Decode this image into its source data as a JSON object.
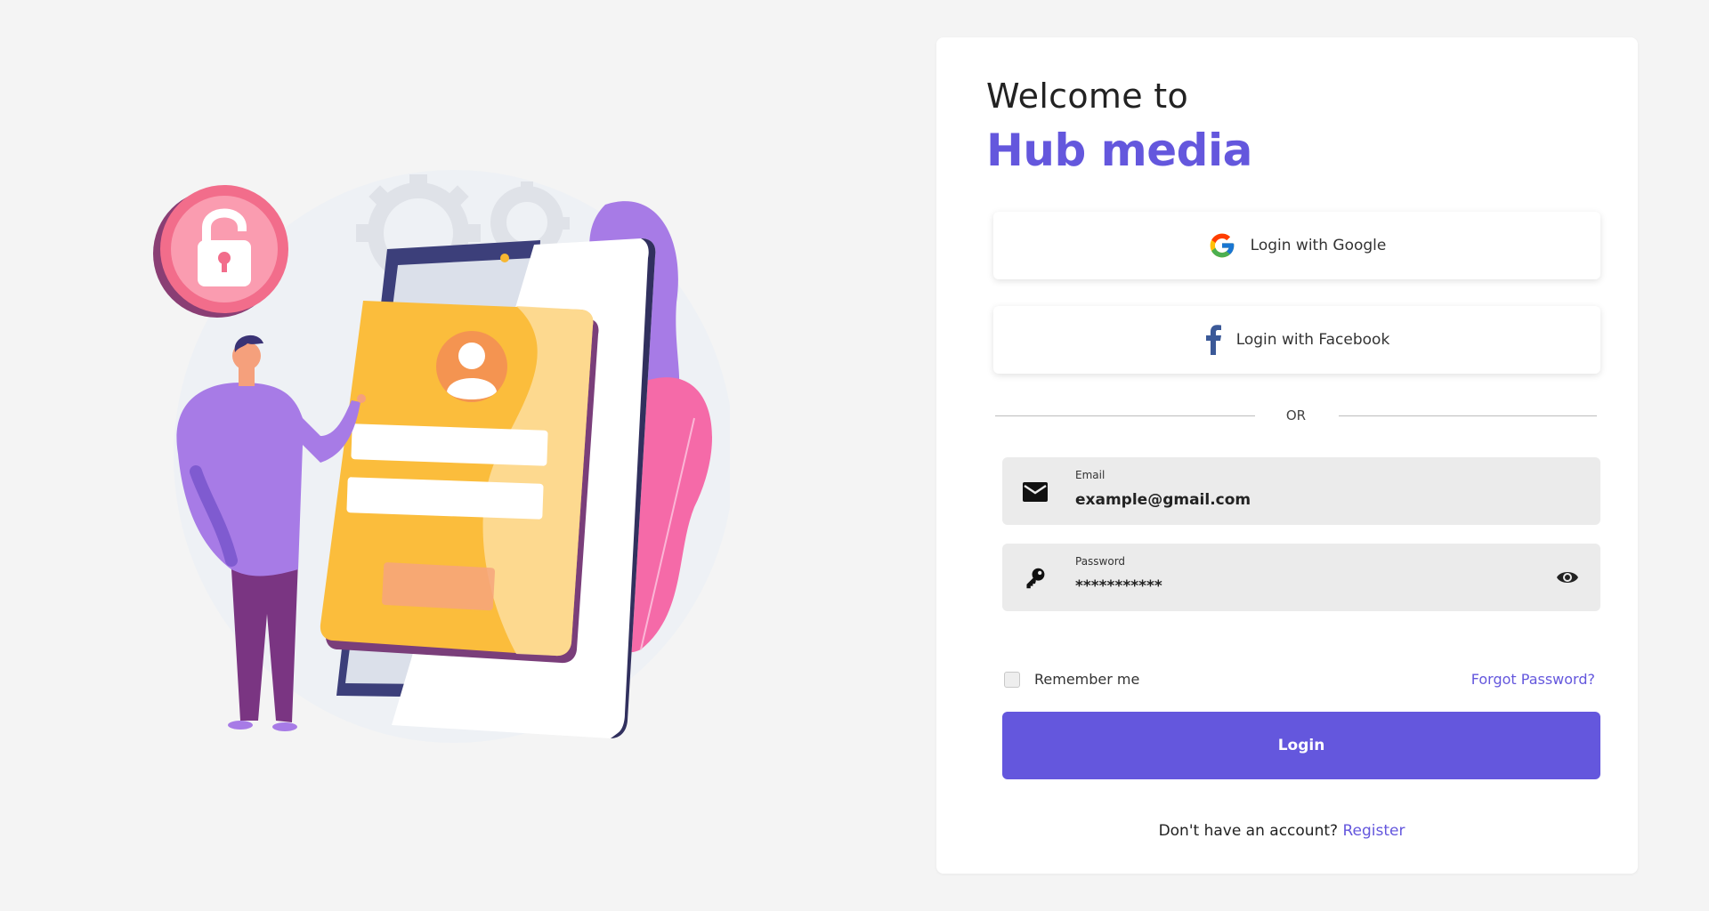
{
  "welcome": {
    "line1": "Welcome to",
    "brand": "Hub media"
  },
  "social": {
    "google_label": "Login with Google",
    "facebook_label": "Login with Facebook"
  },
  "divider_text": "OR",
  "email": {
    "label": "Email",
    "value": "example@gmail.com",
    "icon": "mail-icon"
  },
  "password": {
    "label": "Password",
    "value": "***********",
    "icon": "key-icon",
    "toggle_icon": "eye-icon"
  },
  "remember": {
    "label": "Remember me",
    "checked": false
  },
  "forgot_label": "Forgot Password?",
  "login_label": "Login",
  "register": {
    "prompt": "Don't have an account?",
    "link": "Register"
  },
  "colors": {
    "accent": "#6457dd",
    "background": "#f4f4f4",
    "field_bg": "#ebebeb"
  }
}
